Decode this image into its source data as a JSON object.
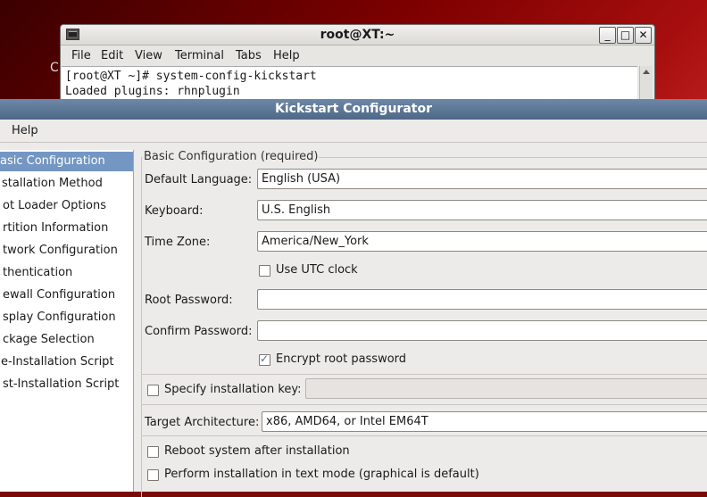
{
  "desktop": {
    "partial_label": "C"
  },
  "terminal": {
    "title": "root@XT:~",
    "menu": [
      "File",
      "Edit",
      "View",
      "Terminal",
      "Tabs",
      "Help"
    ],
    "lines": [
      "[root@XT ~]# system-config-kickstart",
      "Loaded plugins: rhnplugin"
    ],
    "buttons": {
      "minimize": "_",
      "maximize": "□",
      "close": "✕"
    }
  },
  "kickstart": {
    "title": "Kickstart Configurator",
    "menu": {
      "help": "Help"
    },
    "sidebar": [
      "asic Configuration",
      "stallation Method",
      "ot Loader Options",
      "rtition Information",
      "twork Configuration",
      "thentication",
      "ewall Configuration",
      "splay Configuration",
      "ckage Selection",
      "e-Installation Script",
      "st-Installation Script"
    ],
    "sidebar_selected_index": 0,
    "section_title": "Basic Configuration (required)",
    "fields": {
      "language_label": "Default Language:",
      "language_value": "English (USA)",
      "keyboard_label": "Keyboard:",
      "keyboard_value": "U.S. English",
      "timezone_label": "Time Zone:",
      "timezone_value": "America/New_York",
      "utc_label": "Use UTC clock",
      "root_password_label": "Root Password:",
      "root_password_value": "",
      "confirm_password_label": "Confirm Password:",
      "confirm_password_value": "",
      "encrypt_label": "Encrypt root password",
      "install_key_label": "Specify installation key:",
      "install_key_value": "",
      "arch_label": "Target Architecture:",
      "arch_value": "x86, AMD64, or Intel EM64T",
      "reboot_label": "Reboot system after installation",
      "textmode_label": "Perform installation in text mode (graphical is default)"
    },
    "checkboxes": {
      "utc": false,
      "encrypt": true,
      "install_key": false,
      "reboot": false,
      "textmode": false
    }
  }
}
